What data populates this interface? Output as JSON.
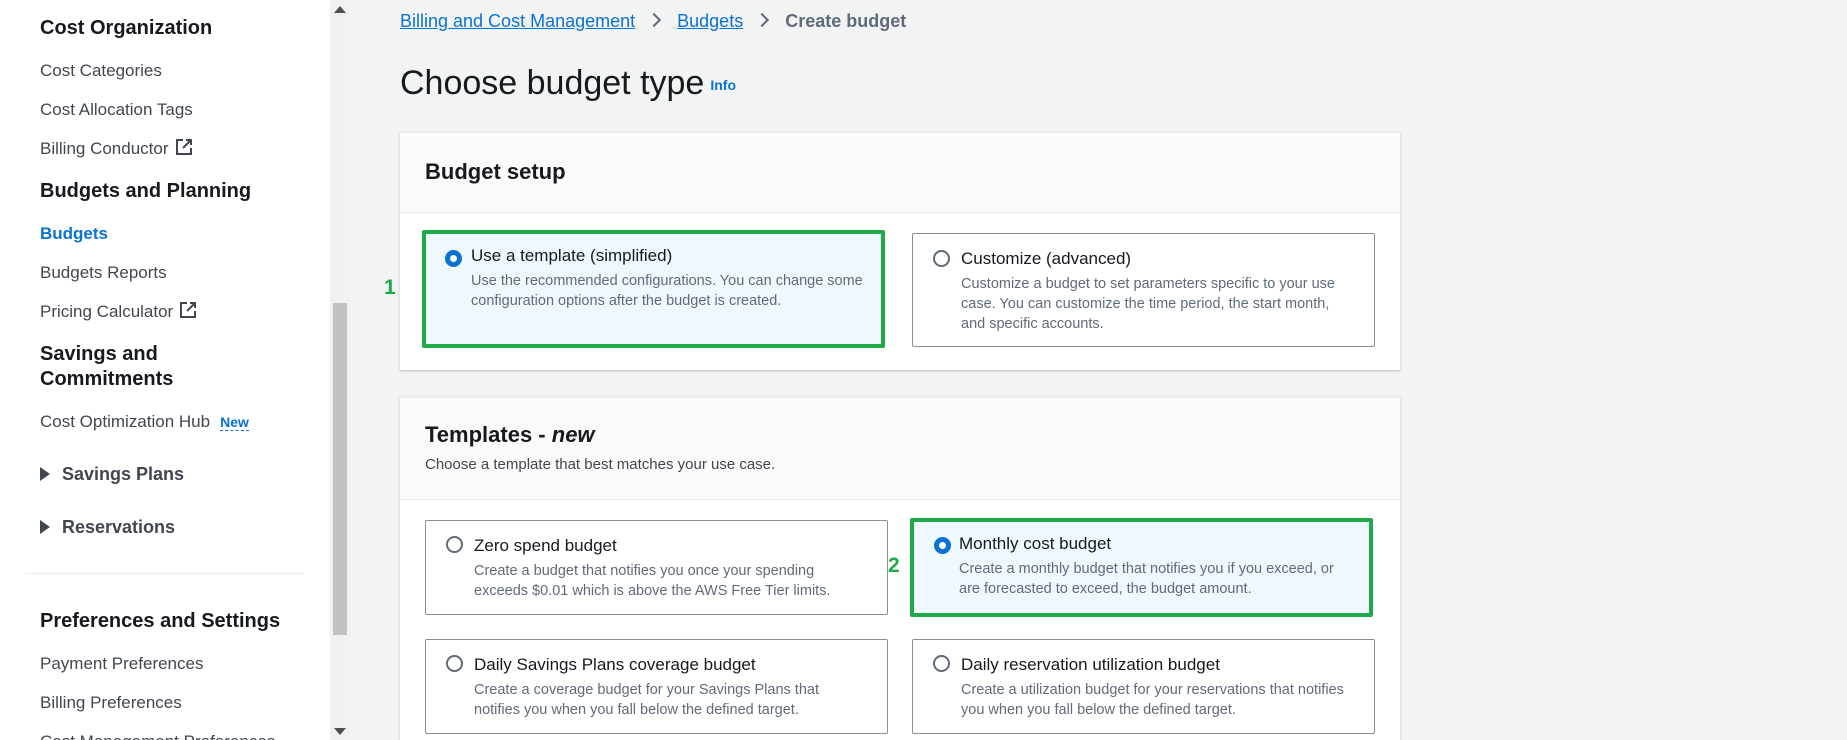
{
  "sidebar": {
    "cost_org_heading": "Cost Organization",
    "cost_categories": "Cost Categories",
    "cost_allocation_tags": "Cost Allocation Tags",
    "billing_conductor": "Billing Conductor",
    "budgets_planning_heading": "Budgets and Planning",
    "budgets": "Budgets",
    "budgets_reports": "Budgets Reports",
    "pricing_calculator": "Pricing Calculator",
    "savings_heading_line1": "Savings and",
    "savings_heading_line2": "Commitments",
    "cost_optimization_hub": "Cost Optimization Hub",
    "new_badge": "New",
    "savings_plans": "Savings Plans",
    "reservations": "Reservations",
    "preferences_heading": "Preferences and Settings",
    "payment_preferences": "Payment Preferences",
    "billing_preferences": "Billing Preferences",
    "cost_management_preferences": "Cost Management Preferences"
  },
  "breadcrumb": {
    "items": [
      "Billing and Cost Management",
      "Budgets"
    ],
    "current": "Create budget"
  },
  "page": {
    "title": "Choose budget type",
    "info": "Info"
  },
  "budget_setup": {
    "title": "Budget setup",
    "options": [
      {
        "title": "Use a template (simplified)",
        "description": "Use the recommended configurations. You can change some configuration options after the budget is created.",
        "selected": true
      },
      {
        "title": "Customize (advanced)",
        "description": "Customize a budget to set parameters specific to your use case. You can customize the time period, the start month, and specific accounts.",
        "selected": false
      }
    ]
  },
  "templates": {
    "title_prefix": "Templates - ",
    "title_em": "new",
    "subtitle": "Choose a template that best matches your use case.",
    "options": [
      {
        "title": "Zero spend budget",
        "description": "Create a budget that notifies you once your spending exceeds $0.01 which is above the AWS Free Tier limits.",
        "selected": false
      },
      {
        "title": "Monthly cost budget",
        "description": "Create a monthly budget that notifies you if you exceed, or are forecasted to exceed, the budget amount.",
        "selected": true
      },
      {
        "title": "Daily Savings Plans coverage budget",
        "description": "Create a coverage budget for your Savings Plans that notifies you when you fall below the defined target.",
        "selected": false
      },
      {
        "title": "Daily reservation utilization budget",
        "description": "Create a utilization budget for your reservations that notifies you when you fall below the defined target.",
        "selected": false
      }
    ]
  },
  "annotations": {
    "step1": "1",
    "step2": "2"
  },
  "colors": {
    "accent": "#0972d3",
    "highlight": "#1eaa48"
  }
}
